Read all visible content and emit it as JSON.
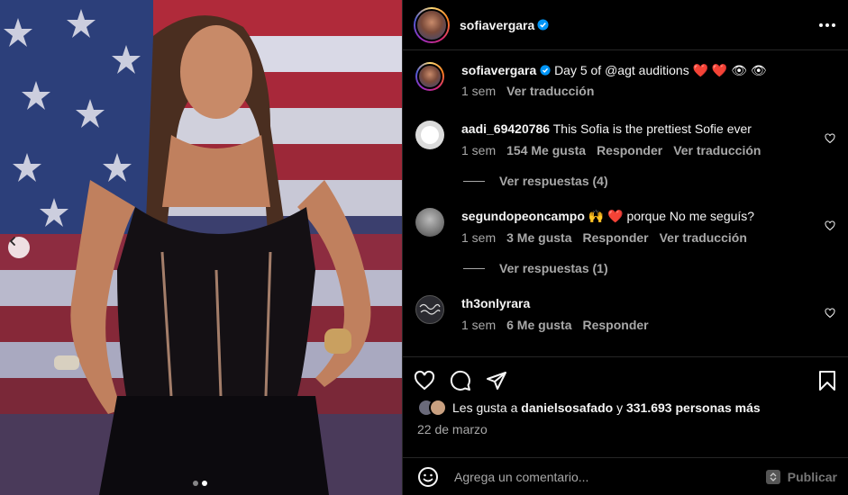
{
  "post": {
    "author": "sofiavergara",
    "caption_author": "sofiavergara",
    "caption_text": "Day 5 of @agt auditions ❤️ ❤️ 👁 👁",
    "caption_time": "1 sem",
    "caption_translate": "Ver traducción"
  },
  "comments": [
    {
      "user": "aadi_69420786",
      "text": "This Sofia is the prettiest Sofie ever",
      "time": "1 sem",
      "likes": "154 Me gusta",
      "reply": "Responder",
      "translate": "Ver traducción",
      "view_replies": "Ver respuestas (4)"
    },
    {
      "user": "segundopeoncampo",
      "text": "🙌 ❤️  porque No me seguís?",
      "time": "1 sem",
      "likes": "3 Me gusta",
      "reply": "Responder",
      "translate": "Ver traducción",
      "view_replies": "Ver respuestas (1)"
    },
    {
      "user": "th3onlyrara",
      "text": "",
      "time": "1 sem",
      "likes": "6 Me gusta",
      "reply": "Responder"
    }
  ],
  "likes": {
    "prefix": "Les gusta a",
    "user": "danielsosafado",
    "connector": "y",
    "others": "331.693 personas más"
  },
  "date": "22 de marzo",
  "composer": {
    "placeholder": "Agrega un comentario...",
    "publish": "Publicar"
  },
  "colors": {
    "background": "#000000",
    "text": "#f5f5f5",
    "secondary": "#a8a8a8",
    "verified": "#0095f6",
    "heart": "#ff3040"
  },
  "carousel": {
    "current": 2,
    "total": 2
  }
}
